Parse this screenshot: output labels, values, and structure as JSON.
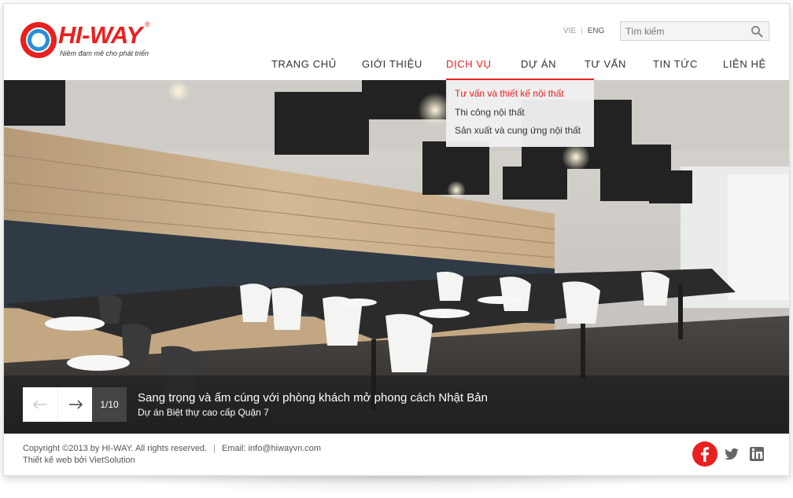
{
  "brand": {
    "name": "HI-WAY",
    "reg": "®",
    "tagline": "Niềm đam mê cho phát triển",
    "color": "#e8201f",
    "accent": "#2a8fd6"
  },
  "lang": {
    "vie": "VIE",
    "sep": "|",
    "eng": "ENG"
  },
  "search": {
    "placeholder": "Tìm kiếm",
    "icon": "search-icon"
  },
  "nav": {
    "items": [
      "TRANG CHỦ",
      "GIỚI THIỆU",
      "DỊCH VỤ",
      "DỰ ÁN",
      "TƯ VẤN",
      "TIN TỨC",
      "LIÊN HỆ"
    ],
    "active": "DỊCH VỤ"
  },
  "dropdown": {
    "items": [
      "Tư vấn và thiết kế nội thất",
      "Thi công nội thất",
      "Sản xuất và cung ứng nội thất"
    ],
    "active": "Tư vấn và thiết kế nội thất"
  },
  "slider": {
    "image": "restaurant-interior-photo",
    "prev_icon": "arrow-left-icon",
    "next_icon": "arrow-right-icon",
    "counter": "1/10",
    "caption_title": "Sang trọng và ấm cúng với phòng khách mở phong cách Nhật Bản",
    "caption_sub": "Dự án Biệt thự cao cấp Quận 7"
  },
  "footer": {
    "copyright": "Copyright ©2013 by HI-WAY. All rights reserved.",
    "sep": "|",
    "email": "Email: info@hiwayvn.com",
    "credit": "Thiết kế web bởi VietSolution",
    "social": [
      "facebook-icon",
      "twitter-icon",
      "linkedin-icon"
    ]
  }
}
